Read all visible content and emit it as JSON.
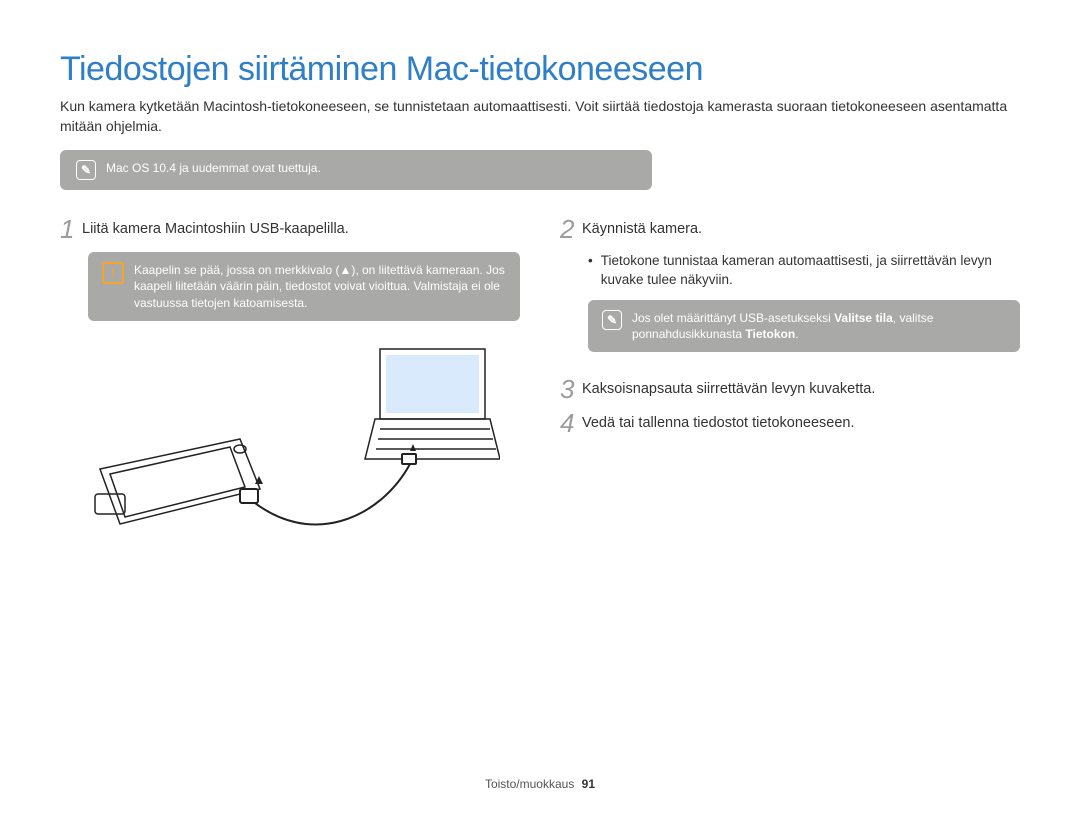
{
  "title": "Tiedostojen siirtäminen Mac-tietokoneeseen",
  "intro": "Kun kamera kytketään Macintosh-tietokoneeseen, se tunnistetaan automaattisesti. Voit siirtää tiedostoja kamerasta suoraan tietokoneeseen asentamatta mitään ohjelmia.",
  "note_top": "Mac OS 10.4 ja uudemmat ovat tuettuja.",
  "left": {
    "step1_num": "1",
    "step1_text": "Liitä kamera Macintoshiin USB-kaapelilla.",
    "warn_text": "Kaapelin se pää, jossa on merkkivalo (▲), on liitettävä kameraan. Jos kaapeli liitetään väärin päin, tiedostot voivat vioittua. Valmistaja ei ole vastuussa tietojen katoamisesta."
  },
  "right": {
    "step2_num": "2",
    "step2_text": "Käynnistä kamera.",
    "step2_bullet": "Tietokone tunnistaa kameran automaattisesti, ja siirrettävän levyn kuvake tulee näkyviin.",
    "note2_pre": "Jos olet määrittänyt USB-asetukseksi ",
    "note2_bold1": "Valitse tila",
    "note2_mid": ", valitse ponnahdusikkunasta ",
    "note2_bold2": "Tietokon",
    "note2_post": ".",
    "step3_num": "3",
    "step3_text": "Kaksoisnapsauta siirrettävän levyn kuvaketta.",
    "step4_num": "4",
    "step4_text": "Vedä tai tallenna tiedostot tietokoneeseen."
  },
  "footer_section": "Toisto/muokkaus",
  "footer_page": "91"
}
